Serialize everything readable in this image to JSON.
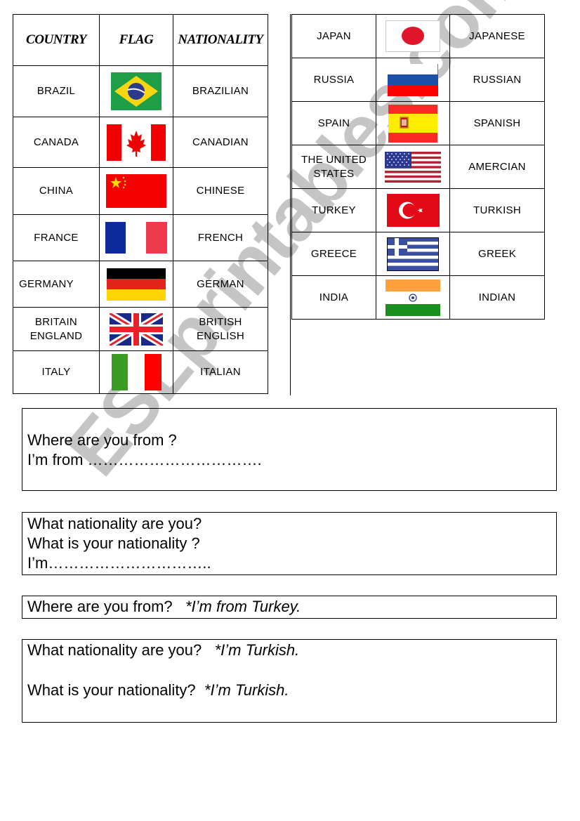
{
  "left_table": {
    "headers": [
      "COUNTRY",
      "FLAG",
      "NATIONALITY"
    ],
    "rows": [
      {
        "country": "BRAZIL",
        "flag": "brazil-flag-icon",
        "nationality": "BRAZILIAN"
      },
      {
        "country": "CANADA",
        "flag": "canada-flag-icon",
        "nationality": "CANADIAN"
      },
      {
        "country": "CHINA",
        "flag": "china-flag-icon",
        "nationality": "CHINESE"
      },
      {
        "country": "FRANCE",
        "flag": "france-flag-icon",
        "nationality": "FRENCH"
      },
      {
        "country": "GERMANY",
        "flag": "germany-flag-icon",
        "nationality": "GERMAN"
      },
      {
        "country": "BRITAIN\nENGLAND",
        "flag": "uk-flag-icon",
        "nationality": "BRITISH\nENGLISH"
      },
      {
        "country": "ITALY",
        "flag": "italy-flag-icon",
        "nationality": "ITALIAN"
      }
    ]
  },
  "right_table": {
    "rows": [
      {
        "country": "JAPAN",
        "flag": "japan-flag-icon",
        "nationality": "JAPANESE"
      },
      {
        "country": "RUSSIA",
        "flag": "russia-flag-icon",
        "nationality": "RUSSIAN"
      },
      {
        "country": "SPAIN",
        "flag": "spain-flag-icon",
        "nationality": "SPANISH"
      },
      {
        "country": "THE UNITED\nSTATES",
        "flag": "usa-flag-icon",
        "nationality": "AMERCIAN"
      },
      {
        "country": "TURKEY",
        "flag": "turkey-flag-icon",
        "nationality": "TURKISH"
      },
      {
        "country": "GREECE",
        "flag": "greece-flag-icon",
        "nationality": "GREEK"
      },
      {
        "country": "INDIA",
        "flag": "india-flag-icon",
        "nationality": "INDIAN"
      }
    ]
  },
  "boxes": {
    "where_from": {
      "question": "Where are you from ?",
      "answer_prompt": "I’m from ……………………………."
    },
    "nationality": {
      "question1": "What nationality are you?",
      "question2": "What is your nationality ?",
      "answer_prompt": "I’m………………………….."
    },
    "example_from": {
      "question": "Where are you from?",
      "answer": "*I’m from Turkey."
    },
    "example_nationality": {
      "question1": "What nationality are you?",
      "answer1": "*I’m Turkish.",
      "question2": "What is your nationality?",
      "answer2": "*I’m Turkish."
    }
  },
  "watermark": "ESLprintables.com"
}
